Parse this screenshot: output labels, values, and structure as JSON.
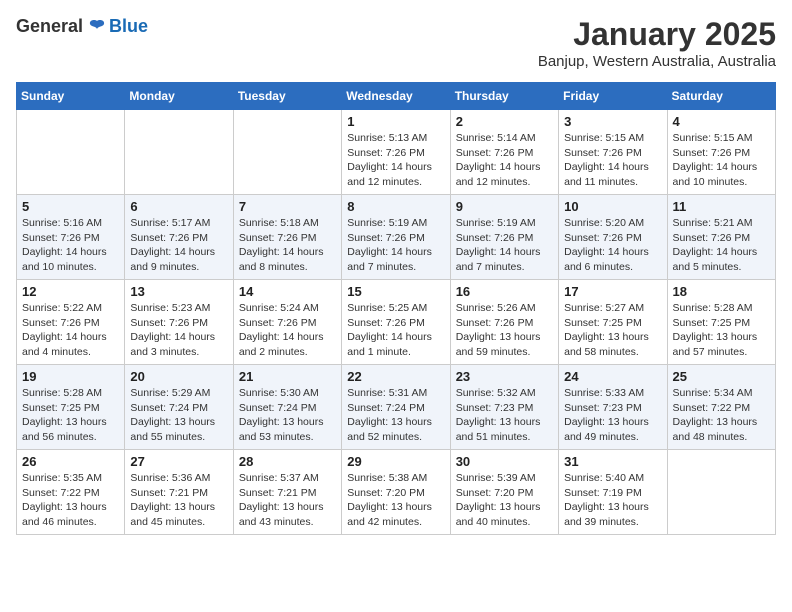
{
  "header": {
    "logo_general": "General",
    "logo_blue": "Blue",
    "month_title": "January 2025",
    "location": "Banjup, Western Australia, Australia"
  },
  "weekdays": [
    "Sunday",
    "Monday",
    "Tuesday",
    "Wednesday",
    "Thursday",
    "Friday",
    "Saturday"
  ],
  "weeks": [
    [
      {
        "day": "",
        "info": ""
      },
      {
        "day": "",
        "info": ""
      },
      {
        "day": "",
        "info": ""
      },
      {
        "day": "1",
        "info": "Sunrise: 5:13 AM\nSunset: 7:26 PM\nDaylight: 14 hours\nand 12 minutes."
      },
      {
        "day": "2",
        "info": "Sunrise: 5:14 AM\nSunset: 7:26 PM\nDaylight: 14 hours\nand 12 minutes."
      },
      {
        "day": "3",
        "info": "Sunrise: 5:15 AM\nSunset: 7:26 PM\nDaylight: 14 hours\nand 11 minutes."
      },
      {
        "day": "4",
        "info": "Sunrise: 5:15 AM\nSunset: 7:26 PM\nDaylight: 14 hours\nand 10 minutes."
      }
    ],
    [
      {
        "day": "5",
        "info": "Sunrise: 5:16 AM\nSunset: 7:26 PM\nDaylight: 14 hours\nand 10 minutes."
      },
      {
        "day": "6",
        "info": "Sunrise: 5:17 AM\nSunset: 7:26 PM\nDaylight: 14 hours\nand 9 minutes."
      },
      {
        "day": "7",
        "info": "Sunrise: 5:18 AM\nSunset: 7:26 PM\nDaylight: 14 hours\nand 8 minutes."
      },
      {
        "day": "8",
        "info": "Sunrise: 5:19 AM\nSunset: 7:26 PM\nDaylight: 14 hours\nand 7 minutes."
      },
      {
        "day": "9",
        "info": "Sunrise: 5:19 AM\nSunset: 7:26 PM\nDaylight: 14 hours\nand 7 minutes."
      },
      {
        "day": "10",
        "info": "Sunrise: 5:20 AM\nSunset: 7:26 PM\nDaylight: 14 hours\nand 6 minutes."
      },
      {
        "day": "11",
        "info": "Sunrise: 5:21 AM\nSunset: 7:26 PM\nDaylight: 14 hours\nand 5 minutes."
      }
    ],
    [
      {
        "day": "12",
        "info": "Sunrise: 5:22 AM\nSunset: 7:26 PM\nDaylight: 14 hours\nand 4 minutes."
      },
      {
        "day": "13",
        "info": "Sunrise: 5:23 AM\nSunset: 7:26 PM\nDaylight: 14 hours\nand 3 minutes."
      },
      {
        "day": "14",
        "info": "Sunrise: 5:24 AM\nSunset: 7:26 PM\nDaylight: 14 hours\nand 2 minutes."
      },
      {
        "day": "15",
        "info": "Sunrise: 5:25 AM\nSunset: 7:26 PM\nDaylight: 14 hours\nand 1 minute."
      },
      {
        "day": "16",
        "info": "Sunrise: 5:26 AM\nSunset: 7:26 PM\nDaylight: 13 hours\nand 59 minutes."
      },
      {
        "day": "17",
        "info": "Sunrise: 5:27 AM\nSunset: 7:25 PM\nDaylight: 13 hours\nand 58 minutes."
      },
      {
        "day": "18",
        "info": "Sunrise: 5:28 AM\nSunset: 7:25 PM\nDaylight: 13 hours\nand 57 minutes."
      }
    ],
    [
      {
        "day": "19",
        "info": "Sunrise: 5:28 AM\nSunset: 7:25 PM\nDaylight: 13 hours\nand 56 minutes."
      },
      {
        "day": "20",
        "info": "Sunrise: 5:29 AM\nSunset: 7:24 PM\nDaylight: 13 hours\nand 55 minutes."
      },
      {
        "day": "21",
        "info": "Sunrise: 5:30 AM\nSunset: 7:24 PM\nDaylight: 13 hours\nand 53 minutes."
      },
      {
        "day": "22",
        "info": "Sunrise: 5:31 AM\nSunset: 7:24 PM\nDaylight: 13 hours\nand 52 minutes."
      },
      {
        "day": "23",
        "info": "Sunrise: 5:32 AM\nSunset: 7:23 PM\nDaylight: 13 hours\nand 51 minutes."
      },
      {
        "day": "24",
        "info": "Sunrise: 5:33 AM\nSunset: 7:23 PM\nDaylight: 13 hours\nand 49 minutes."
      },
      {
        "day": "25",
        "info": "Sunrise: 5:34 AM\nSunset: 7:22 PM\nDaylight: 13 hours\nand 48 minutes."
      }
    ],
    [
      {
        "day": "26",
        "info": "Sunrise: 5:35 AM\nSunset: 7:22 PM\nDaylight: 13 hours\nand 46 minutes."
      },
      {
        "day": "27",
        "info": "Sunrise: 5:36 AM\nSunset: 7:21 PM\nDaylight: 13 hours\nand 45 minutes."
      },
      {
        "day": "28",
        "info": "Sunrise: 5:37 AM\nSunset: 7:21 PM\nDaylight: 13 hours\nand 43 minutes."
      },
      {
        "day": "29",
        "info": "Sunrise: 5:38 AM\nSunset: 7:20 PM\nDaylight: 13 hours\nand 42 minutes."
      },
      {
        "day": "30",
        "info": "Sunrise: 5:39 AM\nSunset: 7:20 PM\nDaylight: 13 hours\nand 40 minutes."
      },
      {
        "day": "31",
        "info": "Sunrise: 5:40 AM\nSunset: 7:19 PM\nDaylight: 13 hours\nand 39 minutes."
      },
      {
        "day": "",
        "info": ""
      }
    ]
  ]
}
